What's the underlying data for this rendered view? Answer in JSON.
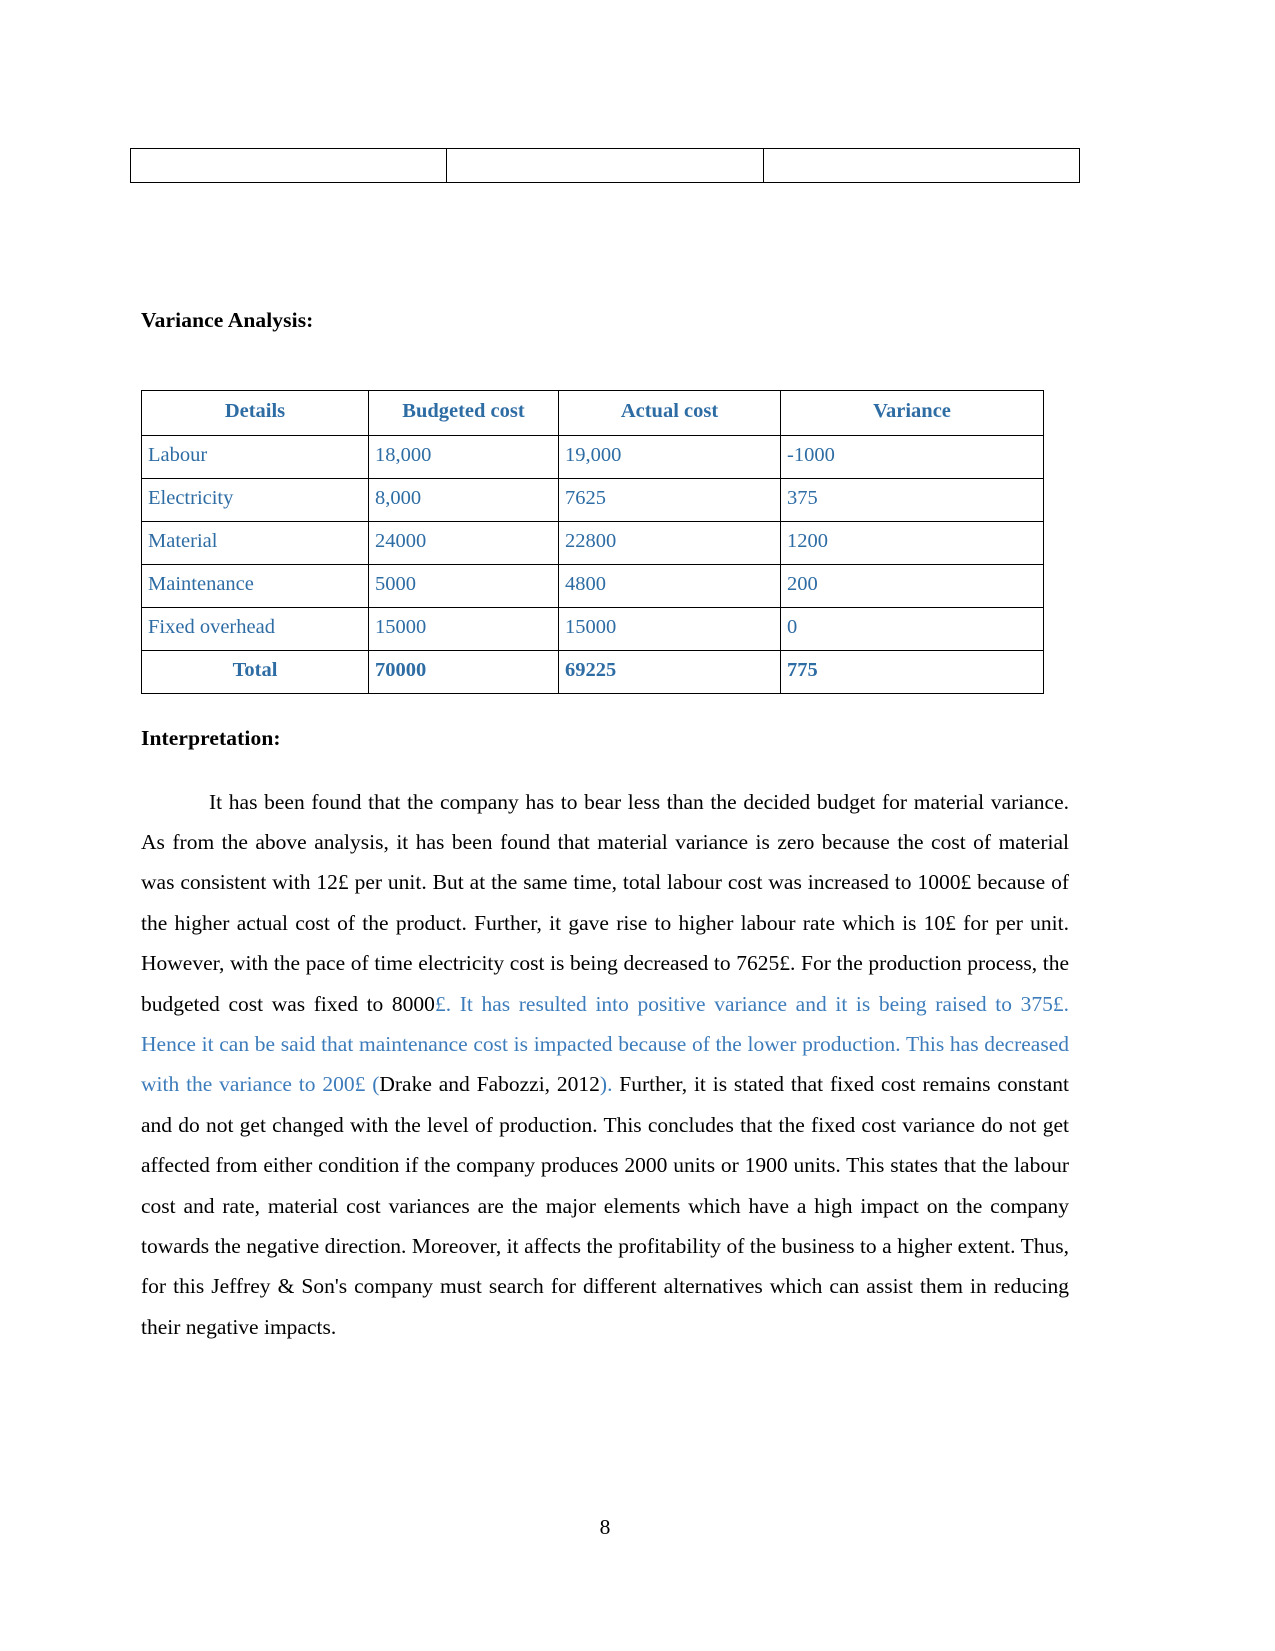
{
  "document": {
    "page_number": "8",
    "accent_color": "#3d7cbb",
    "table_text_color": "#2e6ca4",
    "body_color": "#000000"
  },
  "top_table": {
    "name": "empty-placeholder-table",
    "rows": [
      [
        "",
        "",
        ""
      ]
    ]
  },
  "headings": {
    "variance_analysis": "Variance Analysis:",
    "interpretation": "Interpretation:"
  },
  "variance_table": {
    "columns": [
      "Details",
      "Budgeted cost",
      "Actual cost",
      "Variance"
    ],
    "rows": [
      {
        "details": "Labour",
        "budgeted": "18,000",
        "actual": "19,000",
        "variance": "-1000"
      },
      {
        "details": "Electricity",
        "budgeted": "8,000",
        "actual": "7625",
        "variance": "375"
      },
      {
        "details": "Material",
        "budgeted": "24000",
        "actual": "22800",
        "variance": "1200"
      },
      {
        "details": "Maintenance",
        "budgeted": "5000",
        "actual": "4800",
        "variance": "200"
      },
      {
        "details": "Fixed overhead",
        "budgeted": "15000",
        "actual": "15000",
        "variance": "0"
      }
    ],
    "total": {
      "details": "Total",
      "budgeted": "70000",
      "actual": "69225",
      "variance": "775"
    }
  },
  "interpretation": {
    "segment_black_1": "It has been found that the company has to bear less than the decided budget for material variance. As from the above analysis, it has been found that material variance is zero because the cost of material was consistent with 12£ per unit. But at the same time, total labour cost was increased to 1000£ because of the higher actual cost of the product. Further, it gave rise to higher labour rate which is 10£ for per unit. However, with the pace of time electricity cost is being decreased to 7625£. For the production process, the budgeted cost was fixed to 8000",
    "segment_blue_1": "£. It has resulted into positive variance and it is being raised to 375£. Hence it can be said that maintenance cost is impacted because of the lower production. This has decreased with the variance to 200£ (",
    "segment_black_2": "Drake and Fabozzi, 2012",
    "segment_blue_2": ").",
    "segment_black_3": " Further, it is stated that fixed cost remains constant and do not get changed with the level of production. This concludes that the fixed cost variance do not get affected from either condition if the company produces 2000 units or 1900 units. This states that the labour cost and rate, material cost variances are the major elements which have a high impact on the company towards the negative direction. Moreover, it affects the profitability of the business to a higher extent. Thus, for this Jeffrey & Son's company must search for different alternatives which can assist them in reducing their negative impacts."
  }
}
